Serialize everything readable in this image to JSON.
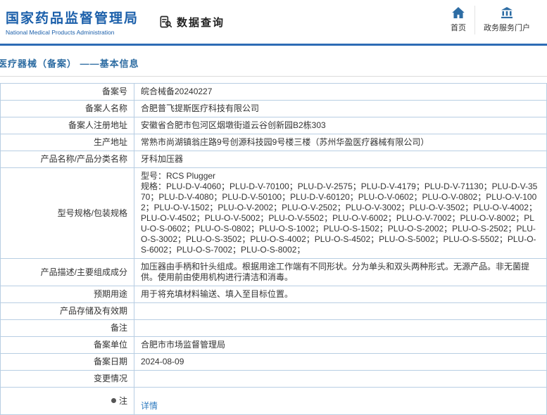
{
  "header": {
    "logo": {
      "title": "国家药品监督管理局",
      "subtitle": "National Medical Products Administration"
    },
    "section": {
      "title": "数据查询",
      "icon": "data-query-icon"
    },
    "nav": [
      {
        "label": "首页",
        "icon": "home-icon"
      },
      {
        "label": "政务服务门户",
        "icon": "building-icon"
      }
    ]
  },
  "page": {
    "title": "医疗器械（备案） ——基本信息"
  },
  "colors": {
    "brand_blue": "#1b5faa",
    "divider_blue": "#2d6cb5",
    "title_blue": "#2d6ca2",
    "table_border": "#b8cee3",
    "link_blue": "#2f7bc0"
  },
  "table": {
    "rows": [
      {
        "label": "备案号",
        "value": "皖合械备20240227"
      },
      {
        "label": "备案人名称",
        "value": "合肥普飞提斯医疗科技有限公司"
      },
      {
        "label": "备案人注册地址",
        "value": "安徽省合肥市包河区烟墩街道云谷创新园B2栋303"
      },
      {
        "label": "生产地址",
        "value": "常熟市尚湖镇翁庄路9号创源科技园9号楼三楼（苏州华盈医疗器械有限公司）"
      },
      {
        "label": "产品名称/产品分类名称",
        "value": "牙科加压器"
      },
      {
        "label": "型号规格/包装规格",
        "value": "型号：RCS Plugger\n规格：PLU-D-V-4060；PLU-D-V-70100；PLU-D-V-2575；PLU-D-V-4179；PLU-D-V-71130；PLU-D-V-3570；PLU-D-V-4080；PLU-D-V-50100；PLU-D-V-60120；PLU-O-V-0602；PLU-O-V-0802；PLU-O-V-1002；PLU-O-V-1502；PLU-O-V-2002；PLU-O-V-2502；PLU-O-V-3002；PLU-O-V-3502；PLU-O-V-4002；PLU-O-V-4502；PLU-O-V-5002；PLU-O-V-5502；PLU-O-V-6002；PLU-O-V-7002；PLU-O-V-8002；PLU-O-S-0602；PLU-O-S-0802；PLU-O-S-1002；PLU-O-S-1502；PLU-O-S-2002；PLU-O-S-2502；PLU-O-S-3002；PLU-O-S-3502；PLU-O-S-4002；PLU-O-S-4502；PLU-O-S-5002；PLU-O-S-5502；PLU-O-S-6002；PLU-O-S-7002；PLU-O-S-8002；"
      },
      {
        "label": "产品描述/主要组成成分",
        "value": "加压器由手柄和针头组成。根据用途工作端有不同形状。分为单头和双头两种形式。无源产品。非无菌提供。使用前由使用机构进行清洁和消毒。"
      },
      {
        "label": "预期用途",
        "value": "用于将充填材料输送、填入至目标位置。"
      },
      {
        "label": "产品存储及有效期",
        "value": ""
      },
      {
        "label": "备注",
        "value": ""
      },
      {
        "label": "备案单位",
        "value": "合肥市市场监督管理局"
      },
      {
        "label": "备案日期",
        "value": "2024-08-09"
      },
      {
        "label": "变更情况",
        "value": ""
      },
      {
        "label": "注",
        "value": "详情",
        "icon": "bullet-icon"
      }
    ]
  }
}
